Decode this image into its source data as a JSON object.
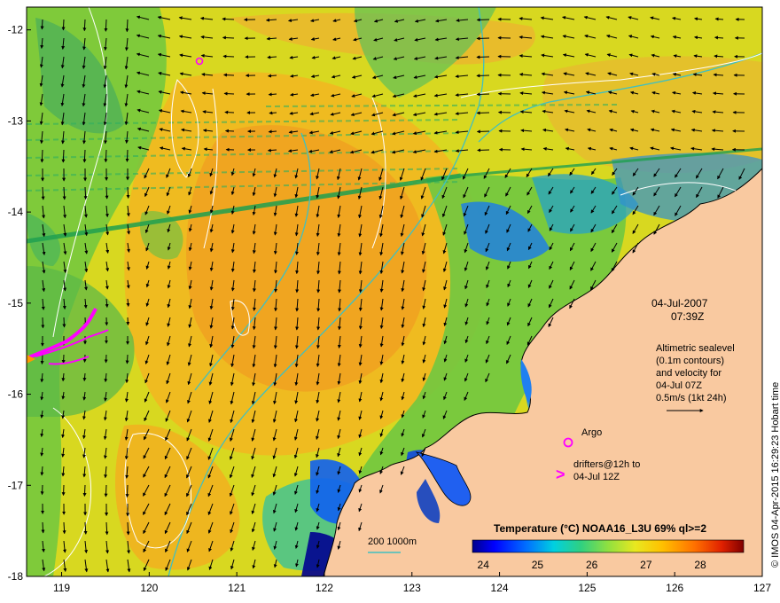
{
  "map": {
    "lon_ticks": [
      "119",
      "120",
      "121",
      "122",
      "123",
      "124",
      "125",
      "126",
      "127"
    ],
    "lat_ticks": [
      "-12",
      "-13",
      "-14",
      "-15",
      "-16",
      "-17",
      "-18"
    ],
    "lon_range": [
      118.6,
      127
    ],
    "lat_range": [
      -18,
      -11.75
    ]
  },
  "annotation": {
    "date": "04-Jul-2007",
    "time": "07:39Z",
    "alt_line1": "Altimetric sealevel",
    "alt_line2": "(0.1m contours)",
    "alt_line3": "and velocity for",
    "alt_line4": "04-Jul 07Z",
    "alt_line5": "0.5m/s (1kt 24h)"
  },
  "legend": {
    "argo_label": "Argo",
    "drifters_line1": "drifters@12h to",
    "drifters_line2": "04-Jul 12Z",
    "drifter_symbol": ">",
    "depth_label": "200  1000m"
  },
  "colorbar": {
    "title": "Temperature (°C) NOAA16_L3U 69% ql>=2",
    "ticks": [
      "24",
      "25",
      "26",
      "27",
      "28"
    ],
    "range": [
      23.8,
      28.8
    ]
  },
  "credit": "© IMOS 04-Apr-2015 16:29:23 Hobart time",
  "colors": {
    "land": "#f9c9a0",
    "drifter": "#ff00ff",
    "argo": "#ff00ff",
    "bathymetry": "#40c0c0",
    "contour": "#ffffff",
    "vector": "#000000"
  }
}
